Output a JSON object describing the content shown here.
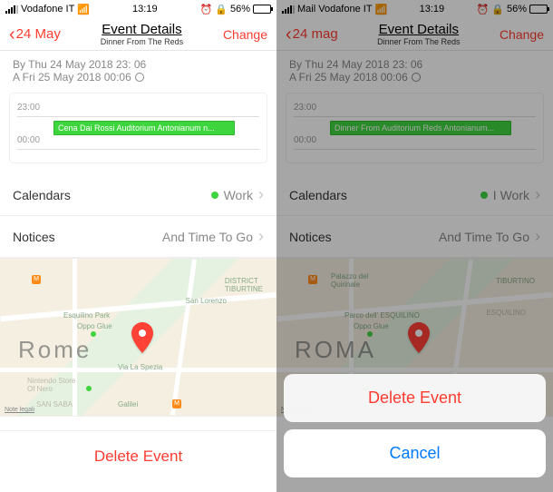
{
  "status": {
    "carrier_left": "Vodafone IT",
    "carrier_right": "Mail Vodafone IT",
    "time": "13:19",
    "battery": "56%"
  },
  "left": {
    "back": "24 May",
    "title": "Event Details",
    "subtitle": "Dinner From The Reds",
    "change": "Change",
    "date_start": "By Thu 24 May 2018 23: 06",
    "date_end": "A Fri 25 May 2018 00:06",
    "hour1": "23:00",
    "hour2": "00:00",
    "event_block": "Cena Dai Rossi Auditorium Antonianum n...",
    "calendars_label": "Calendars",
    "calendars_value": "Work",
    "notice_label": "Notices",
    "notice_value": "And Time To Go",
    "map_city": "Rome",
    "park_lbl": "Esquilino Park",
    "legal": "Note legali",
    "delete": "Delete Event"
  },
  "right": {
    "back": "24 mag",
    "title": "Event Details",
    "subtitle": "Dinner From The Reds",
    "change": "Change",
    "date_start": "By Thu 24 May 2018 23: 06",
    "date_end": "A Fri 25 May 2018 00:06",
    "hour1": "23:00",
    "hour2": "00:00",
    "event_block": "Dinner From Auditorium Reds Antonianum...",
    "calendars_label": "Calendars",
    "calendars_value": "I Work",
    "notice_label": "Notices",
    "notice_value": "And Time To Go",
    "map_city": "ROMA",
    "park_lbl": "Parco dell' ESQUILINO",
    "legal": "Note legali",
    "delete_btn": "Delete Event",
    "cancel_btn": "Cancel"
  }
}
